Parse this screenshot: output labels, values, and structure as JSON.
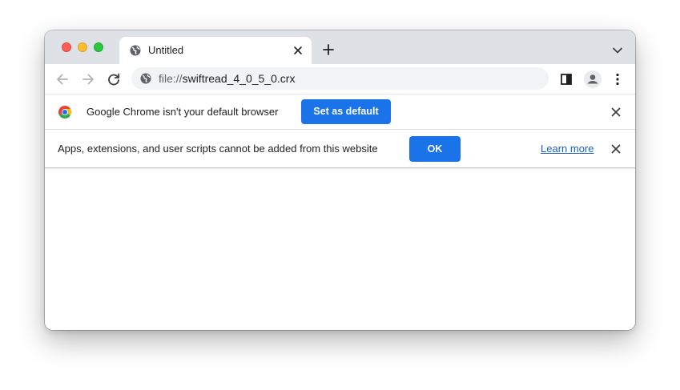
{
  "window": {
    "traffic_lights": [
      "close",
      "minimize",
      "maximize"
    ]
  },
  "tab": {
    "title": "Untitled",
    "favicon": "globe-icon",
    "close": "close-icon"
  },
  "tabstrip": {
    "new_tab_icon": "plus-icon",
    "tab_search_icon": "chevron-down-icon"
  },
  "toolbar": {
    "back_icon": "arrow-left-icon",
    "forward_icon": "arrow-right-icon",
    "reload_icon": "reload-icon",
    "side_panel_icon": "side-panel-icon",
    "profile_icon": "profile-icon",
    "menu_icon": "kebab-menu-icon"
  },
  "omnibox": {
    "scheme": "file://",
    "path": "swiftread_4_0_5_0.crx",
    "icon": "globe-icon"
  },
  "default_browser_bar": {
    "message": "Google Chrome isn't your default browser",
    "button_label": "Set as default",
    "icon": "chrome-logo-icon"
  },
  "extension_bar": {
    "message": "Apps, extensions, and user scripts cannot be added from this website",
    "button_label": "OK",
    "link_label": "Learn more"
  },
  "colors": {
    "accent": "#1a73e8",
    "tabstrip": "#dee1e6",
    "link": "#1a5fc4"
  }
}
